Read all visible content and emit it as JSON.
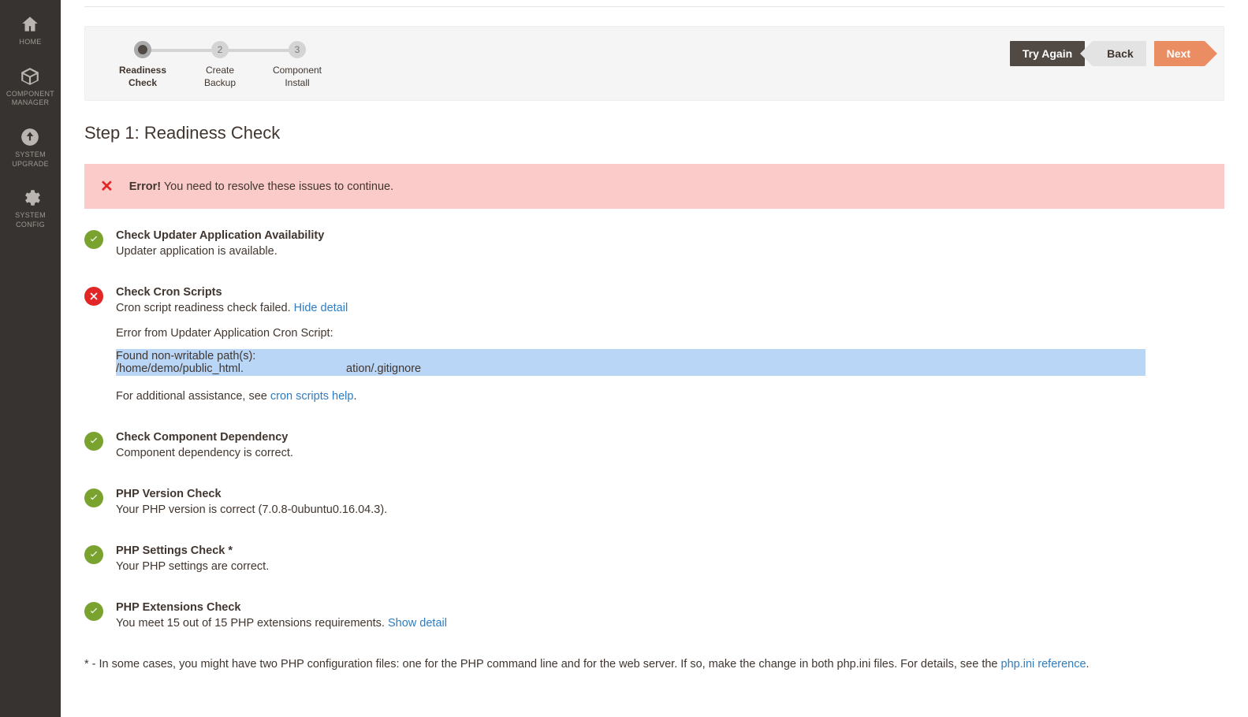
{
  "sidebar": {
    "items": [
      {
        "label": "HOME"
      },
      {
        "label": "COMPONENT\nMANAGER"
      },
      {
        "label": "SYSTEM\nUPGRADE"
      },
      {
        "label": "SYSTEM\nCONFIG"
      }
    ]
  },
  "wizard": {
    "steps": [
      {
        "num": "1",
        "label": "Readiness\nCheck"
      },
      {
        "num": "2",
        "label": "Create\nBackup"
      },
      {
        "num": "3",
        "label": "Component\nInstall"
      }
    ],
    "actions": {
      "try_again": "Try Again",
      "back": "Back",
      "next": "Next"
    }
  },
  "page": {
    "title": "Step 1: Readiness Check"
  },
  "alert": {
    "strong": "Error!",
    "text": "You need to resolve these issues to continue."
  },
  "checks": [
    {
      "title": "Check Updater Application Availability",
      "desc": "Updater application is available."
    },
    {
      "title": "Check Cron Scripts",
      "desc": "Cron script readiness check failed.",
      "hide_detail": "Hide detail",
      "detail": {
        "heading": "Error from Updater Application Cron Script:",
        "found_label": "Found non-writable path(s):",
        "path_prefix": "/home/demo/public_html.",
        "path_suffix": "ation/.gitignore",
        "assist_prefix": "For additional assistance, see",
        "assist_link": "cron scripts help",
        "assist_suffix": "."
      }
    },
    {
      "title": "Check Component Dependency",
      "desc": "Component dependency is correct."
    },
    {
      "title": "PHP Version Check",
      "desc": "Your PHP version is correct (7.0.8-0ubuntu0.16.04.3)."
    },
    {
      "title": "PHP Settings Check *",
      "desc": "Your PHP settings are correct."
    },
    {
      "title": "PHP Extensions Check",
      "desc": "You meet 15 out of 15 PHP extensions requirements.",
      "show_detail": "Show detail"
    }
  ],
  "footnote": {
    "text": "* - In some cases, you might have two PHP configuration files: one for the PHP command line and for the web server. If so, make the change in both php.ini files. For details, see the",
    "link": "php.ini reference",
    "suffix": "."
  }
}
